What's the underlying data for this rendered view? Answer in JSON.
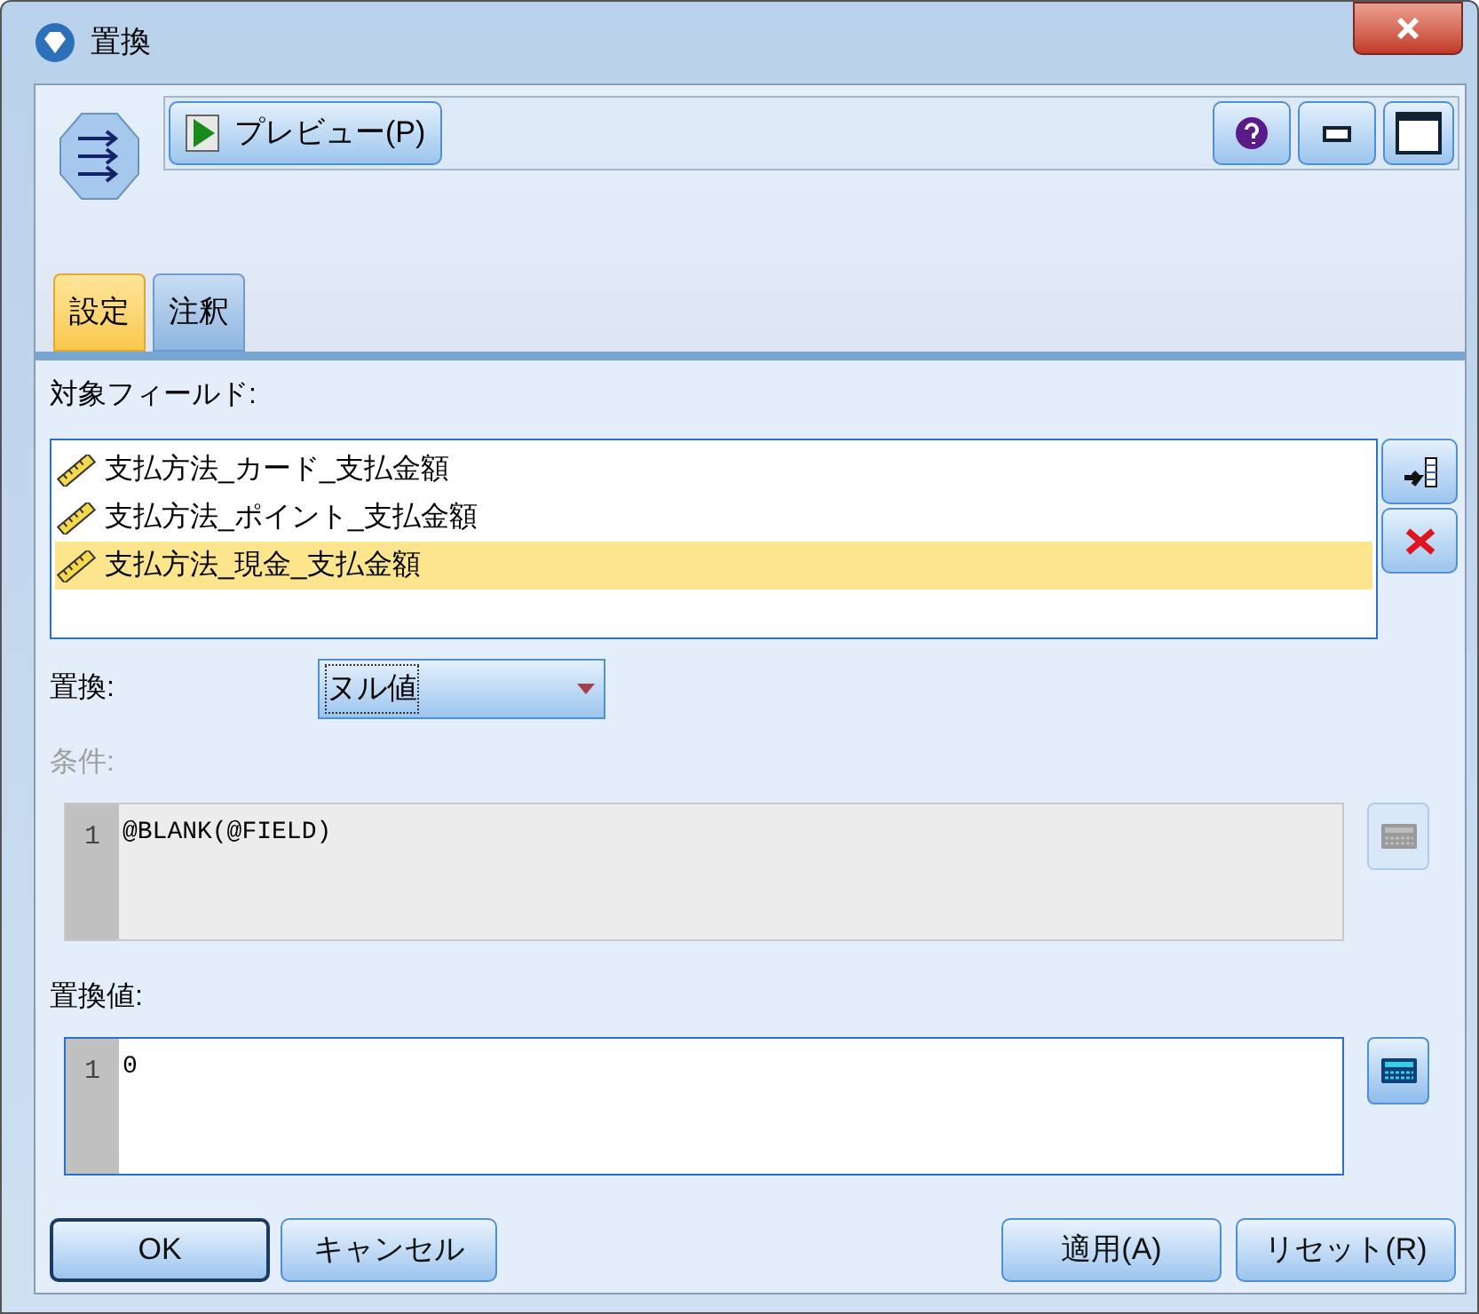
{
  "window": {
    "title": "置換"
  },
  "toolbar": {
    "preview_button": "プレビュー(P)"
  },
  "tabs": [
    {
      "label": "設定",
      "selected": true
    },
    {
      "label": "注釈",
      "selected": false
    }
  ],
  "fields": {
    "label": "対象フィールド:",
    "items": [
      {
        "name": "支払方法_カード_支払金額",
        "selected": false
      },
      {
        "name": "支払方法_ポイント_支払金額",
        "selected": false
      },
      {
        "name": "支払方法_現金_支払金額",
        "selected": true
      }
    ]
  },
  "replace": {
    "label": "置換:",
    "value": "ヌル値"
  },
  "condition": {
    "label": "条件:",
    "disabled": true,
    "lines": [
      {
        "number": "1",
        "text": "@BLANK(@FIELD)"
      }
    ]
  },
  "replace_value": {
    "label": "置換値:",
    "disabled": false,
    "lines": [
      {
        "number": "1",
        "text": "0"
      }
    ]
  },
  "buttons_left": [
    {
      "label": "OK",
      "default": true
    },
    {
      "label": "キャンセル",
      "default": false
    }
  ],
  "buttons_right": [
    {
      "label": "適用(A)",
      "default": false
    },
    {
      "label": "リセット(R)",
      "default": false
    }
  ]
}
